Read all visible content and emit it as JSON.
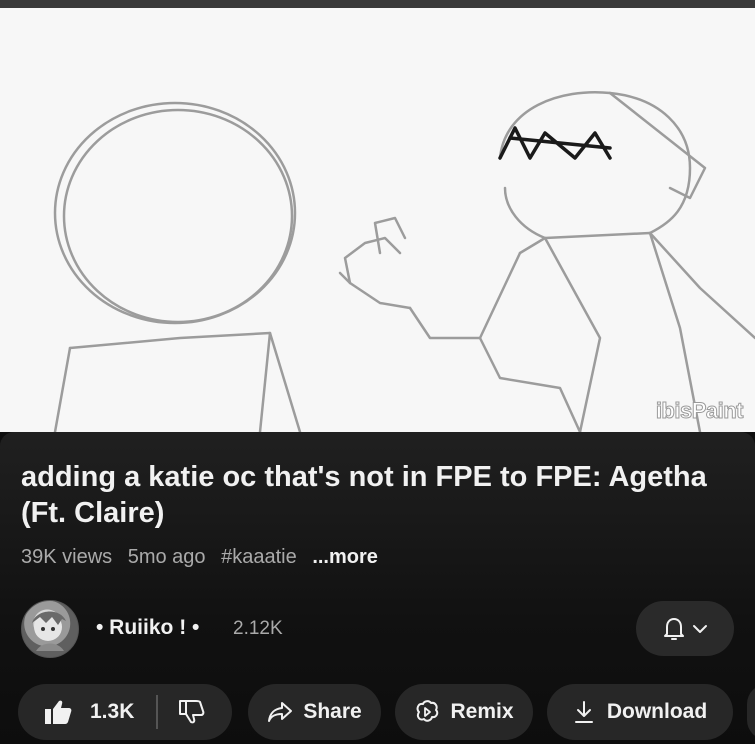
{
  "video": {
    "watermark": "ibisPaint"
  },
  "title": "adding a katie oc that's not in FPE to FPE: Agetha (Ft. Claire)",
  "meta": {
    "views": "39K views",
    "age": "5mo ago",
    "hashtag": "#kaaatie",
    "more": "...more"
  },
  "channel": {
    "name": "• Ruiiko ! •",
    "subscribers": "2.12K"
  },
  "actions": {
    "likes": "1.3K",
    "share": "Share",
    "remix": "Remix",
    "download": "Download"
  },
  "icons": [
    "thumbs-up-icon",
    "thumbs-down-icon",
    "share-icon",
    "remix-icon",
    "download-icon",
    "bell-icon",
    "chevron-down-icon"
  ]
}
